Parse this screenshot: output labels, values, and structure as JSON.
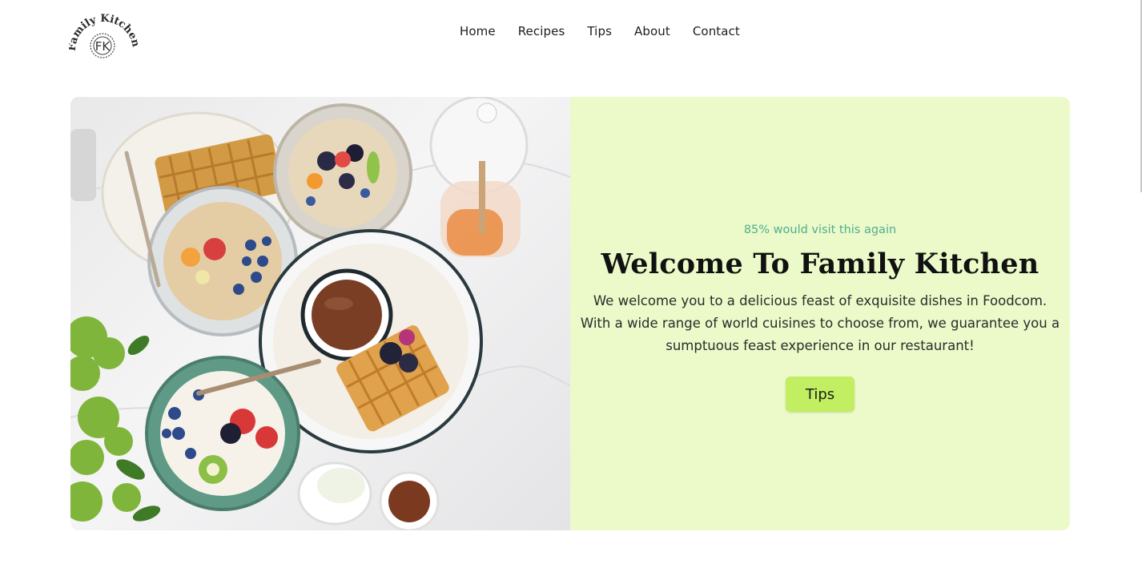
{
  "brand": {
    "logo_text": "Family Kitchen",
    "logo_monogram": "FK"
  },
  "nav": {
    "items": [
      {
        "label": "Home"
      },
      {
        "label": "Recipes"
      },
      {
        "label": "Tips"
      },
      {
        "label": "About"
      },
      {
        "label": "Contact"
      }
    ]
  },
  "hero": {
    "image_alt": "breakfast-table-photo",
    "tagline": "85% would visit this again",
    "title": "Welcome To Family Kitchen",
    "description": "We welcome you to a delicious feast of exquisite dishes in Foodcom. With a wide range of world cuisines to choose from, we guarantee you a sumptuous feast experience in our restaurant!",
    "button_label": "Tips"
  },
  "colors": {
    "panel_bg": "#ebfac8",
    "tagline": "#4fae92",
    "button_bg": "#c2ef62"
  }
}
